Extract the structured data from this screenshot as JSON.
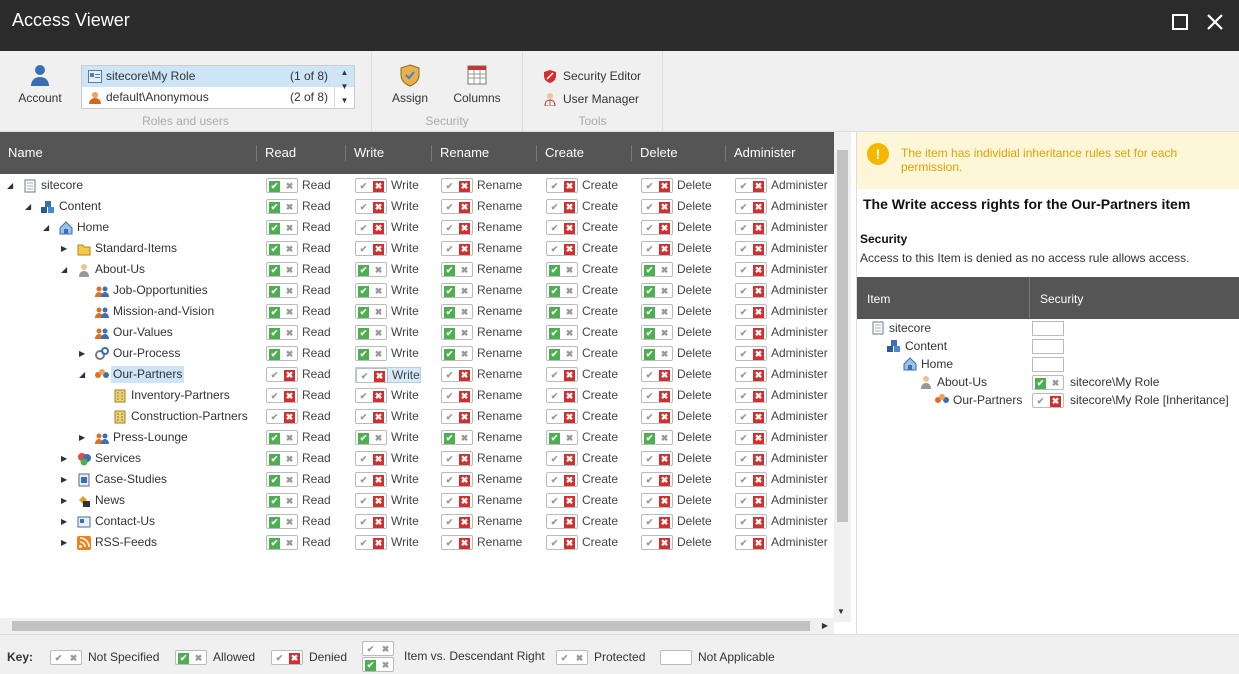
{
  "window": {
    "title": "Access Viewer"
  },
  "ribbon": {
    "account_label": "Account",
    "accounts": [
      {
        "name": "sitecore\\My Role",
        "count": "(1 of 8)",
        "selected": true
      },
      {
        "name": "default\\Anonymous",
        "count": "(2 of 8)",
        "selected": false
      }
    ],
    "roles_group_label": "Roles and users",
    "assign_label": "Assign",
    "columns_label": "Columns",
    "security_group_label": "Security",
    "security_editor_label": "Security Editor",
    "user_manager_label": "User Manager",
    "tools_group_label": "Tools"
  },
  "grid": {
    "columns": [
      "Name",
      "Read",
      "Write",
      "Rename",
      "Create",
      "Delete",
      "Administer"
    ],
    "rows": [
      {
        "name": "sitecore",
        "depth": 0,
        "arrow": "down",
        "icon": "page-icon",
        "perms": [
          "an",
          "nd",
          "nd",
          "nd",
          "nd",
          "nd"
        ]
      },
      {
        "name": "Content",
        "depth": 1,
        "arrow": "down",
        "icon": "cubes-icon",
        "perms": [
          "an",
          "nd",
          "nd",
          "nd",
          "nd",
          "nd"
        ]
      },
      {
        "name": "Home",
        "depth": 2,
        "arrow": "down",
        "icon": "home-icon",
        "perms": [
          "an",
          "nd",
          "nd",
          "nd",
          "nd",
          "nd"
        ]
      },
      {
        "name": "Standard-Items",
        "depth": 3,
        "arrow": "right",
        "icon": "folder-icon",
        "perms": [
          "an",
          "nd",
          "nd",
          "nd",
          "nd",
          "nd"
        ]
      },
      {
        "name": "About-Us",
        "depth": 3,
        "arrow": "down",
        "icon": "person-icon",
        "perms": [
          "an",
          "an",
          "an",
          "an",
          "an",
          "nd"
        ]
      },
      {
        "name": "Job-Opportunities",
        "depth": 4,
        "arrow": "",
        "icon": "people-icon",
        "perms": [
          "an",
          "an",
          "an",
          "an",
          "an",
          "nd"
        ]
      },
      {
        "name": "Mission-and-Vision",
        "depth": 4,
        "arrow": "",
        "icon": "people-icon",
        "perms": [
          "an",
          "an",
          "an",
          "an",
          "an",
          "nd"
        ]
      },
      {
        "name": "Our-Values",
        "depth": 4,
        "arrow": "",
        "icon": "people-icon",
        "perms": [
          "an",
          "an",
          "an",
          "an",
          "an",
          "nd"
        ]
      },
      {
        "name": "Our-Process",
        "depth": 4,
        "arrow": "right",
        "icon": "gears-icon",
        "perms": [
          "an",
          "an",
          "an",
          "an",
          "an",
          "nd"
        ]
      },
      {
        "name": "Our-Partners",
        "depth": 4,
        "arrow": "down",
        "icon": "partners-icon",
        "perms": [
          "nd",
          "nd",
          "nd",
          "nd",
          "nd",
          "nd"
        ],
        "selected": true
      },
      {
        "name": "Inventory-Partners",
        "depth": 5,
        "arrow": "",
        "icon": "building-icon",
        "perms": [
          "nd",
          "nd",
          "nd",
          "nd",
          "nd",
          "nd"
        ]
      },
      {
        "name": "Construction-Partners",
        "depth": 5,
        "arrow": "",
        "icon": "building-icon",
        "perms": [
          "nd",
          "nd",
          "nd",
          "nd",
          "nd",
          "nd"
        ]
      },
      {
        "name": "Press-Lounge",
        "depth": 4,
        "arrow": "right",
        "icon": "people-icon",
        "perms": [
          "an",
          "an",
          "an",
          "an",
          "an",
          "nd"
        ]
      },
      {
        "name": "Services",
        "depth": 3,
        "arrow": "right",
        "icon": "services-icon",
        "perms": [
          "an",
          "nd",
          "nd",
          "nd",
          "nd",
          "nd"
        ]
      },
      {
        "name": "Case-Studies",
        "depth": 3,
        "arrow": "right",
        "icon": "case-icon",
        "perms": [
          "an",
          "nd",
          "nd",
          "nd",
          "nd",
          "nd"
        ]
      },
      {
        "name": "News",
        "depth": 3,
        "arrow": "right",
        "icon": "news-icon",
        "perms": [
          "an",
          "nd",
          "nd",
          "nd",
          "nd",
          "nd"
        ]
      },
      {
        "name": "Contact-Us",
        "depth": 3,
        "arrow": "right",
        "icon": "contact-icon",
        "perms": [
          "an",
          "nd",
          "nd",
          "nd",
          "nd",
          "nd"
        ]
      },
      {
        "name": "RSS-Feeds",
        "depth": 3,
        "arrow": "right",
        "icon": "rss-icon",
        "perms": [
          "an",
          "nd",
          "nd",
          "nd",
          "nd",
          "nd"
        ]
      }
    ]
  },
  "details": {
    "notice": "The item has individial inheritance rules set for each permission.",
    "title": "The Write access rights for the Our-Partners item",
    "section": "Security",
    "description": "Access to this Item is denied as no access rule allows access.",
    "columns": [
      "Item",
      "Security"
    ],
    "rows": [
      {
        "name": "sitecore",
        "depth": 0,
        "icon": "page-icon",
        "state": "",
        "text": ""
      },
      {
        "name": "Content",
        "depth": 1,
        "icon": "cubes-icon",
        "state": "",
        "text": ""
      },
      {
        "name": "Home",
        "depth": 2,
        "icon": "home-icon",
        "state": "",
        "text": ""
      },
      {
        "name": "About-Us",
        "depth": 3,
        "icon": "person-icon",
        "state": "an",
        "text": "sitecore\\My Role"
      },
      {
        "name": "Our-Partners",
        "depth": 4,
        "icon": "partners-icon",
        "state": "nd",
        "text": "sitecore\\My Role [Inheritance]"
      }
    ]
  },
  "key": {
    "label": "Key:",
    "items": [
      "Not Specified",
      "Allowed",
      "Denied",
      "Item vs. Descendant Right",
      "Protected",
      "Not Applicable"
    ]
  },
  "colors": {
    "allowed": "#4caf50",
    "denied": "#d32f2f",
    "titlebar": "#2b2b2b",
    "header": "#555555",
    "selected": "#cde6f7"
  }
}
